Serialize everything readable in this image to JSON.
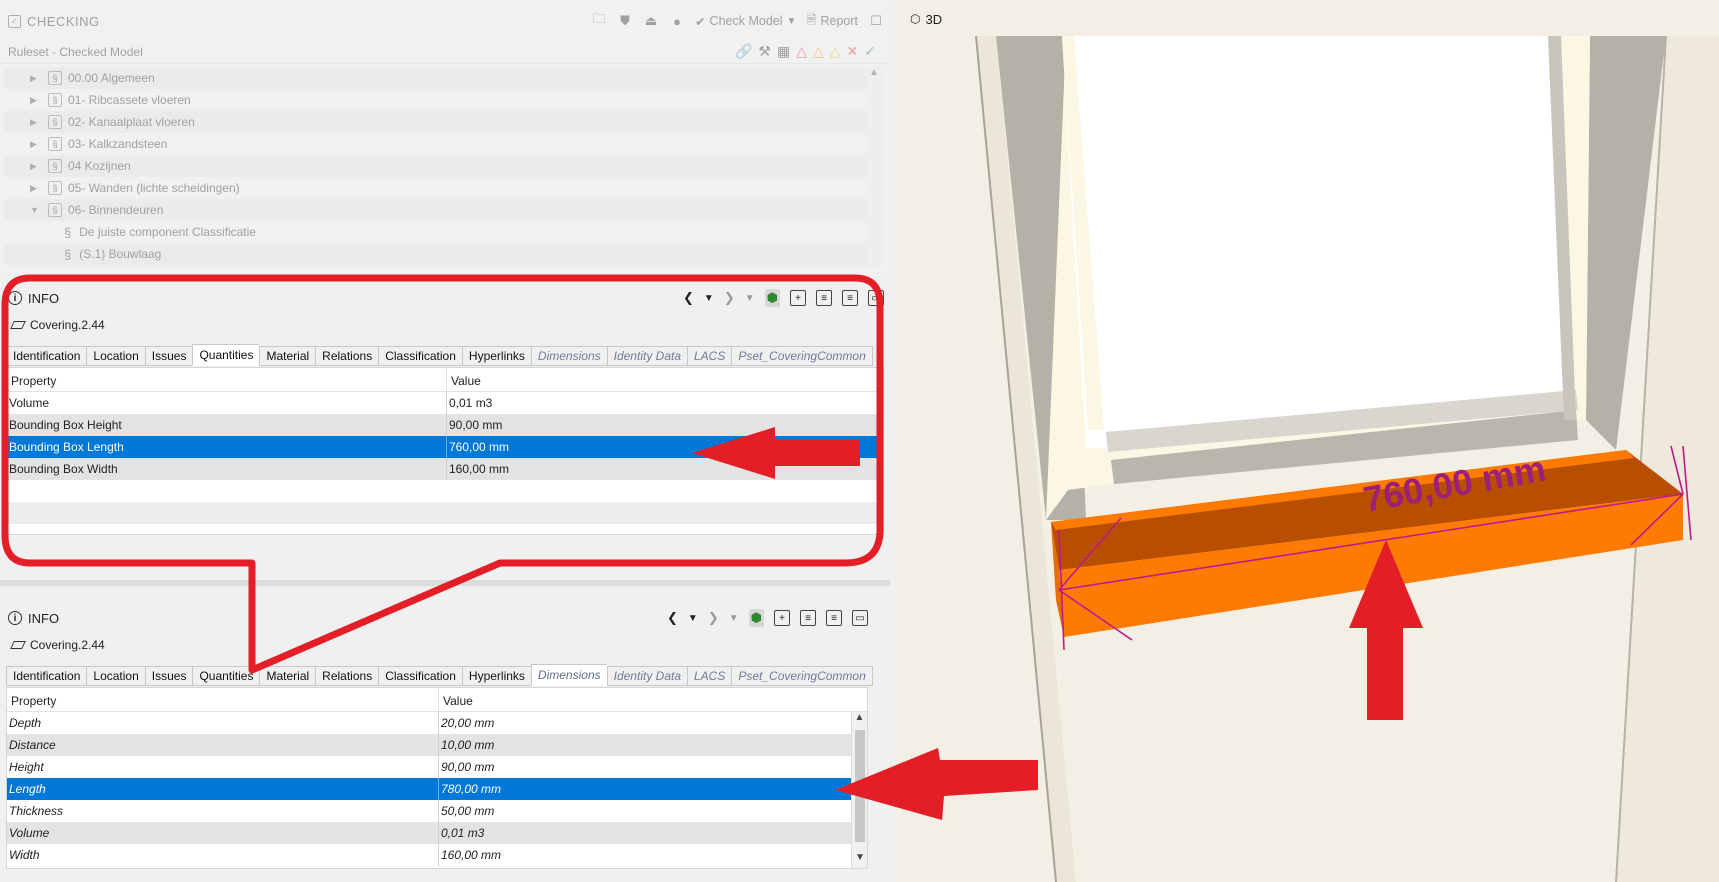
{
  "checking": {
    "title": "CHECKING",
    "check_model_label": "Check Model",
    "report_label": "Report",
    "ruleset_header": "Ruleset - Checked Model",
    "tree": [
      {
        "label": "00.00 Algemeen",
        "expanded": false
      },
      {
        "label": "01- Ribcassete vloeren",
        "expanded": false
      },
      {
        "label": "02- Kanaalplaat vloeren",
        "expanded": false
      },
      {
        "label": "03- Kalkzandsteen",
        "expanded": false
      },
      {
        "label": "04 Kozijnen",
        "expanded": false
      },
      {
        "label": "05- Wanden (lichte scheidingen)",
        "expanded": false
      },
      {
        "label": "06- Binnendeuren",
        "expanded": true
      },
      {
        "label": "De juiste component Classificatie",
        "child": true
      },
      {
        "label": "(S.1) Bouwlaag",
        "child": true
      }
    ]
  },
  "info_top": {
    "title": "INFO",
    "entity": "Covering.2.44",
    "tabs": [
      "Identification",
      "Location",
      "Issues",
      "Quantities",
      "Material",
      "Relations",
      "Classification",
      "Hyperlinks",
      "Dimensions",
      "Identity Data",
      "LACS",
      "Pset_CoveringCommon"
    ],
    "active_tab": "Quantities",
    "col_property": "Property",
    "col_value": "Value",
    "rows": [
      {
        "property": "Volume",
        "value": "0,01 m3"
      },
      {
        "property": "Bounding Box Height",
        "value": "90,00 mm"
      },
      {
        "property": "Bounding Box Length",
        "value": "760,00 mm",
        "selected": true
      },
      {
        "property": "Bounding Box Width",
        "value": "160,00 mm"
      }
    ]
  },
  "info_bottom": {
    "title": "INFO",
    "entity": "Covering.2.44",
    "tabs": [
      "Identification",
      "Location",
      "Issues",
      "Quantities",
      "Material",
      "Relations",
      "Classification",
      "Hyperlinks",
      "Dimensions",
      "Identity Data",
      "LACS",
      "Pset_CoveringCommon"
    ],
    "active_tab": "Dimensions",
    "col_property": "Property",
    "col_value": "Value",
    "rows": [
      {
        "property": "Depth",
        "value": "20,00 mm"
      },
      {
        "property": "Distance",
        "value": "10,00 mm"
      },
      {
        "property": "Height",
        "value": "90,00 mm"
      },
      {
        "property": "Length",
        "value": "780,00 mm",
        "selected": true
      },
      {
        "property": "Thickness",
        "value": "50,00 mm"
      },
      {
        "property": "Volume",
        "value": "0,01 m3"
      },
      {
        "property": "Width",
        "value": "160,00 mm"
      }
    ]
  },
  "view3d": {
    "title": "3D",
    "dimension_label": "760,00 mm"
  },
  "colors": {
    "selection": "#0078d7",
    "annotation_red": "#e41e26",
    "sill_orange": "#ff7a00",
    "dimension_magenta": "#c0198c"
  }
}
